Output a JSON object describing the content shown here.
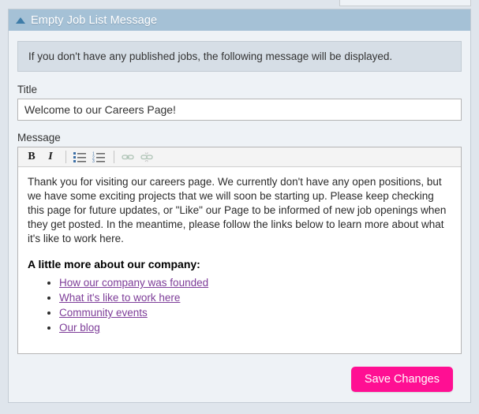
{
  "panel": {
    "title": "Empty Job List Message",
    "collapse_icon": "triangle-up-icon"
  },
  "info": {
    "text": "If you don't have any published jobs, the following message will be displayed."
  },
  "title_field": {
    "label": "Title",
    "value": "Welcome to our Careers Page!",
    "placeholder": ""
  },
  "message_field": {
    "label": "Message",
    "toolbar": [
      {
        "name": "bold-button",
        "glyph": "B",
        "disabled": false
      },
      {
        "name": "italic-button",
        "glyph": "I",
        "disabled": false
      },
      {
        "name": "bulleted-list-button",
        "glyph": "",
        "disabled": false
      },
      {
        "name": "numbered-list-button",
        "glyph": "",
        "disabled": false
      },
      {
        "name": "insert-link-button",
        "glyph": "",
        "disabled": true
      },
      {
        "name": "unlink-button",
        "glyph": "",
        "disabled": true
      }
    ],
    "body": {
      "paragraph": "Thank you for visiting our careers page. We currently don't have any open positions, but we have some exciting projects that we will soon be starting up. Please keep checking this page for future updates, or \"Like\" our Page to be informed of new job openings when they get posted. In the meantime, please follow the links below to learn more about what it's like to work here.",
      "heading": "A little more about our company:",
      "links": [
        "How our company was founded",
        "What it's like to work here",
        "Community events",
        "Our blog"
      ]
    }
  },
  "footer": {
    "save_label": "Save Changes"
  },
  "colors": {
    "header_bar": "#a5c1d6",
    "collapse_triangle": "#3e7ca8",
    "panel_background": "#eef2f6",
    "info_box": "#d6dee6",
    "page_background": "#dfe5ec",
    "save_button": "#ff0f93",
    "link": "#7d3c98"
  }
}
